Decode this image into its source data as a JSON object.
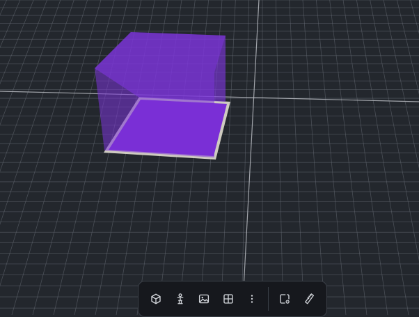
{
  "viewport": {
    "background_color": "#23272d",
    "grid_line_color": "#6a7078",
    "axis_line_color": "#b8bcc2",
    "object": {
      "type": "box",
      "fill_color": "#7b35d9",
      "base_outline_color": "#d8d4c8"
    }
  },
  "toolbar": {
    "background_color": "#16181d",
    "icon_color": "#d4d7dc",
    "buttons": [
      {
        "name": "cube-icon"
      },
      {
        "name": "mannequin-icon"
      },
      {
        "name": "image-icon"
      },
      {
        "name": "grid-layout-icon"
      },
      {
        "name": "more-vertical-icon"
      },
      {
        "name": "add-frame-icon"
      },
      {
        "name": "ruler-icon"
      }
    ]
  }
}
